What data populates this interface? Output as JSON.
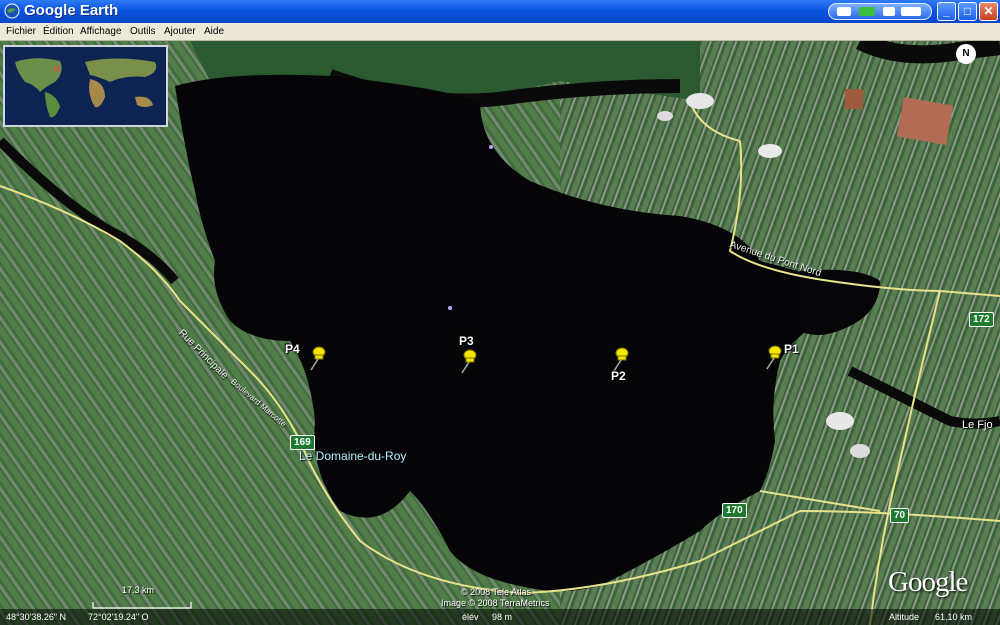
{
  "window": {
    "title": "Google Earth",
    "buttons": {
      "minimize": "_",
      "maximize": "□",
      "close": "✕"
    }
  },
  "menu": [
    "Fichier",
    "Édition",
    "Affichage",
    "Outils",
    "Ajouter",
    "Aide"
  ],
  "placemarks": [
    {
      "id": "P1",
      "label": "P1"
    },
    {
      "id": "P2",
      "label": "P2"
    },
    {
      "id": "P3",
      "label": "P3"
    },
    {
      "id": "P4",
      "label": "P4"
    }
  ],
  "map_labels": {
    "region": "Le Domaine-du-Roy",
    "avenue": "Avenue du Pont Nord",
    "rue": "Rue Principale",
    "boulevard": "Boulevard Marcotte",
    "fjord": "Le Fjo"
  },
  "routes": [
    "172",
    "169",
    "170",
    "70"
  ],
  "compass": "N",
  "status": {
    "scale": "17.3 km",
    "latitude": "48°30'38.26\" N",
    "longitude": "72°02'19.24\" O",
    "elev_label": "élév",
    "elevation": "98 m",
    "altitude_label": "Altitude",
    "altitude": "61.10 km"
  },
  "attribution": {
    "line1": "© 2008 Tele Atlas",
    "line2": "Image © 2008 TerraMetrics",
    "logo": "Google"
  },
  "colors": {
    "titlebar": "#0a55e0",
    "lake": "#050507",
    "land": "#3f6b3a",
    "pin": "#f5e600",
    "road": "#e8e28a"
  }
}
